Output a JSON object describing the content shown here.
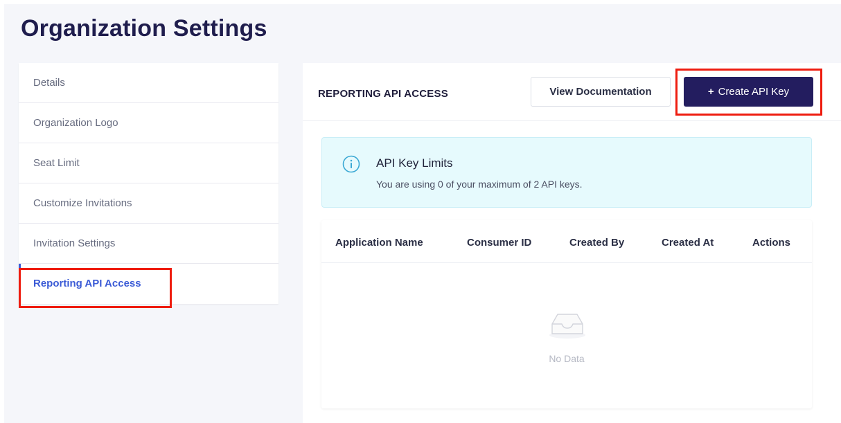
{
  "page": {
    "title": "Organization Settings"
  },
  "sidebar": {
    "items": [
      {
        "label": "Details"
      },
      {
        "label": "Organization Logo"
      },
      {
        "label": "Seat Limit"
      },
      {
        "label": "Customize Invitations"
      },
      {
        "label": "Invitation Settings"
      },
      {
        "label": "Reporting API Access",
        "active": true
      }
    ]
  },
  "panel": {
    "title": "REPORTING API ACCESS",
    "view_docs_label": "View Documentation",
    "create_label_icon": "+",
    "create_label": "Create API Key"
  },
  "info": {
    "icon": "info-circle-icon",
    "title": "API Key Limits",
    "text": "You are using 0 of your maximum of 2 API keys."
  },
  "table": {
    "columns": [
      "Application Name",
      "Consumer ID",
      "Created By",
      "Created At",
      "Actions"
    ],
    "rows": [],
    "empty_text": "No Data",
    "empty_icon": "empty-inbox-icon"
  },
  "colors": {
    "brand_dark": "#231d5f",
    "accent_blue": "#3b5bd6",
    "highlight_red": "#ee1c0f",
    "info_bg": "#e6fafd",
    "info_icon": "#3aa8d4"
  }
}
